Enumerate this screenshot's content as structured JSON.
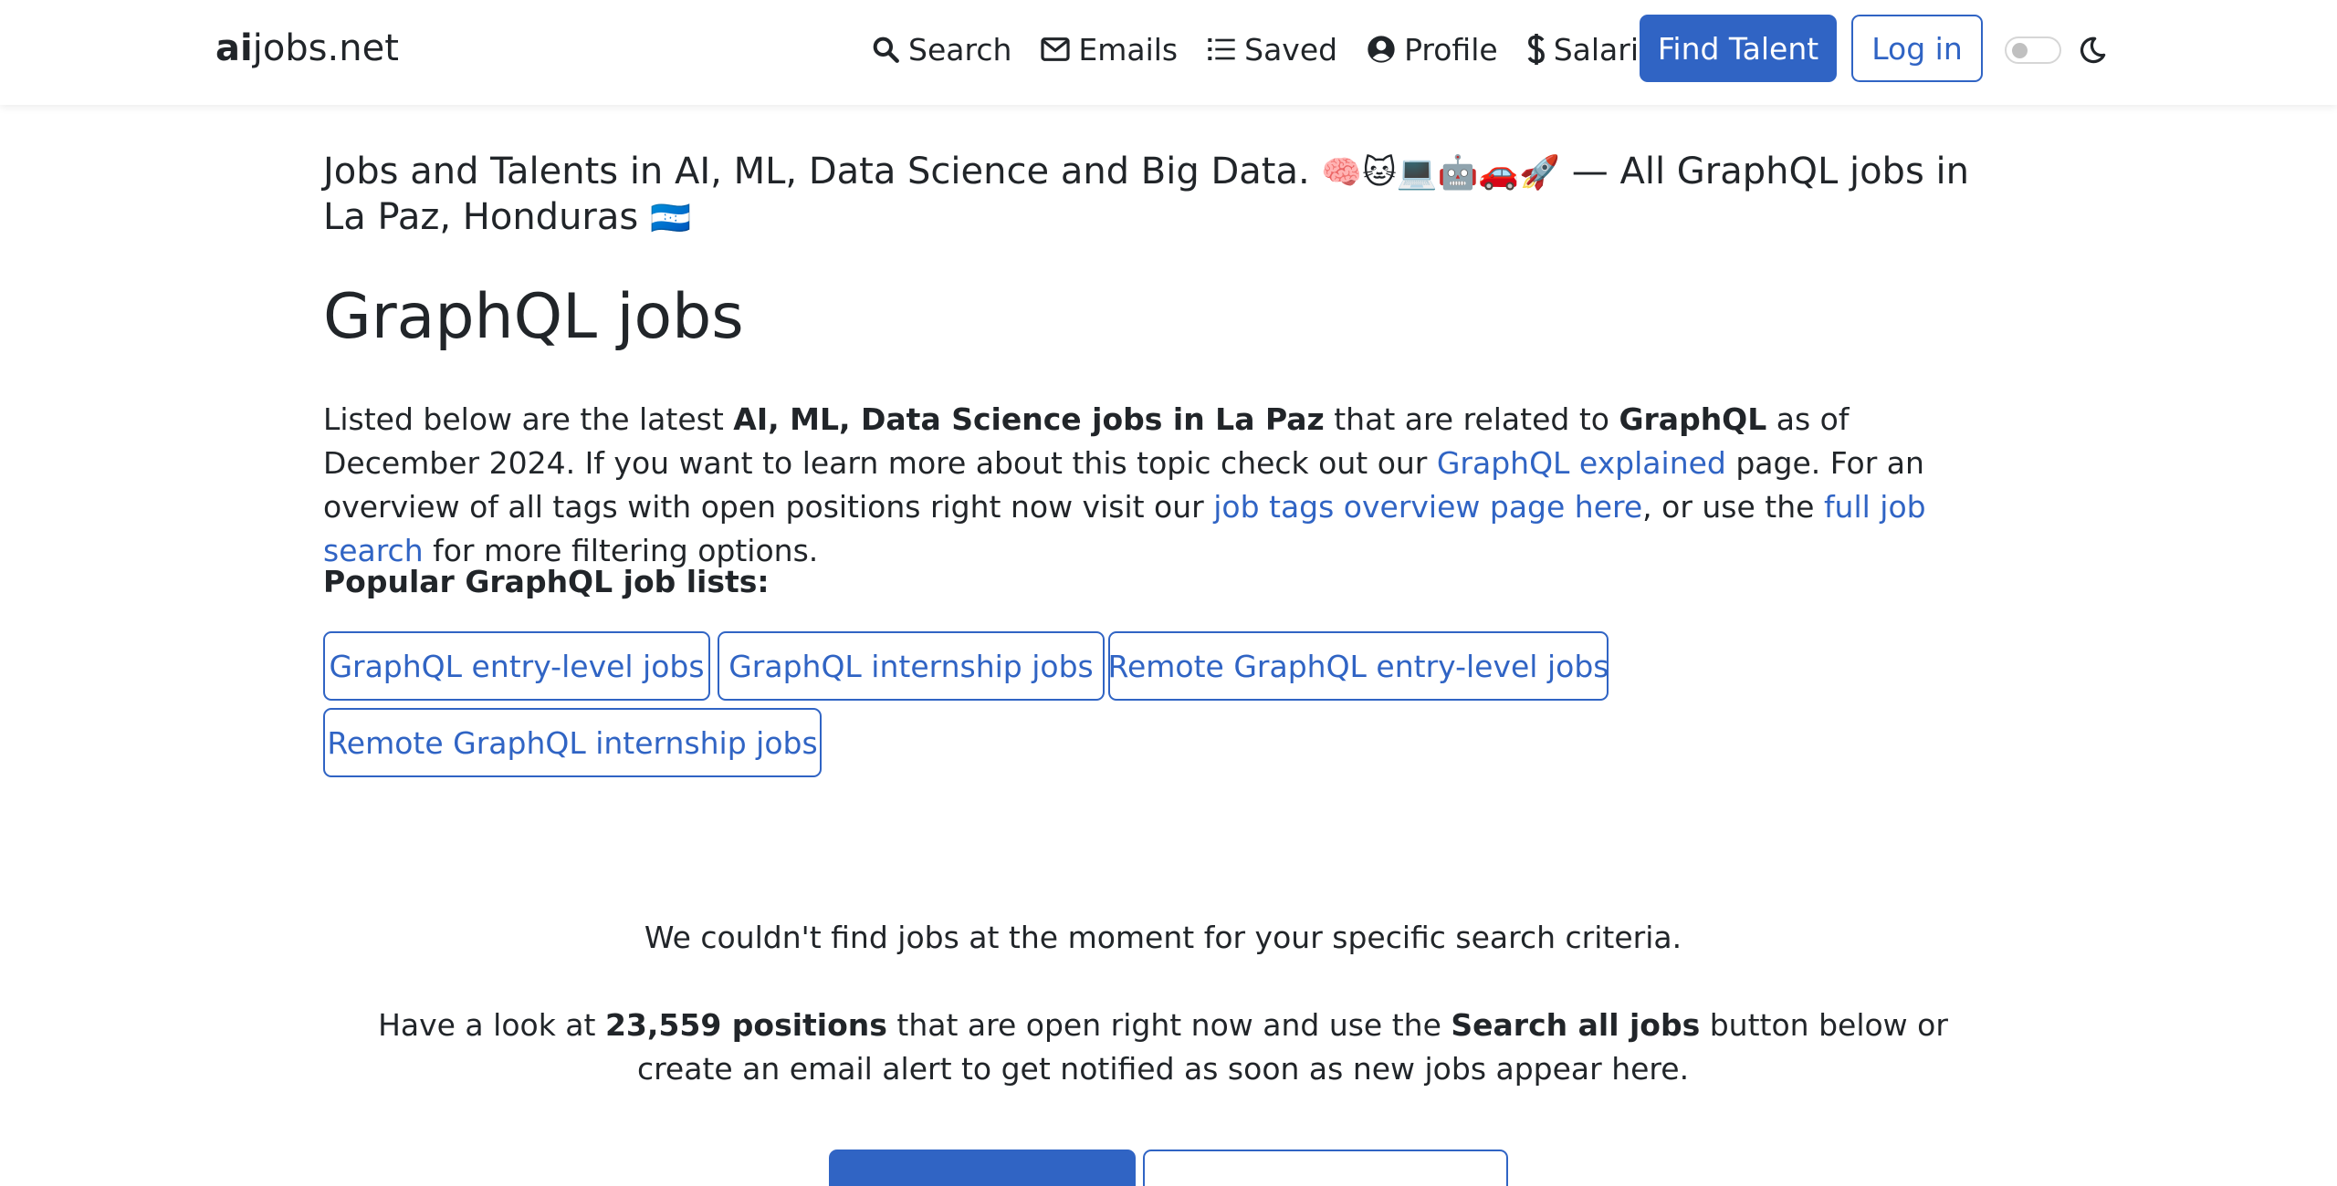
{
  "header": {
    "brand_bold": "ai",
    "brand_rest": "jobs.net",
    "nav": [
      {
        "icon": "search-icon",
        "label": "Search"
      },
      {
        "icon": "envelope-icon",
        "label": "Emails"
      },
      {
        "icon": "list-icon",
        "label": "Saved"
      },
      {
        "icon": "user-circle-icon",
        "label": "Profile"
      },
      {
        "icon": "dollar-icon",
        "label": "Salaries"
      }
    ],
    "find_talent": "Find Talent",
    "login": "Log in"
  },
  "lead": {
    "text1": "Jobs and Talents in AI, ML, Data Science and Big Data.",
    "emojis": "🧠🐱💻🤖🚗🚀",
    "text2": "— All GraphQL jobs in La Paz, Honduras",
    "flag": "🇭🇳"
  },
  "title": "GraphQL jobs",
  "intro": {
    "p1": "Listed below are the latest ",
    "b1": "AI, ML, Data Science jobs in La Paz",
    "p2": " that are related to ",
    "b2": "GraphQL",
    "p3": " as of December 2024. If you want to learn more about this topic check out our ",
    "l1": "GraphQL explained",
    "p4": " page. For an overview of all tags with open positions right now visit our ",
    "l2": "job tags overview page here",
    "p5": ", or use the ",
    "l3": "full job search",
    "p6": " for more filtering options."
  },
  "popular_label": "Popular GraphQL job lists:",
  "popular_lists": [
    "GraphQL entry-level jobs",
    "GraphQL internship jobs",
    "Remote GraphQL entry-level jobs",
    "Remote GraphQL internship jobs"
  ],
  "no_jobs": "We couldn't find jobs at the moment for your specific search criteria.",
  "suggest": {
    "p1": "Have a look at ",
    "b1": "23,559 positions",
    "p2": " that are open right now and use the ",
    "b2": "Search all jobs",
    "p3": " button below or create an email alert to get notified as soon as new jobs appear here."
  },
  "colors": {
    "primary": "#3064c4",
    "text": "#212529"
  }
}
